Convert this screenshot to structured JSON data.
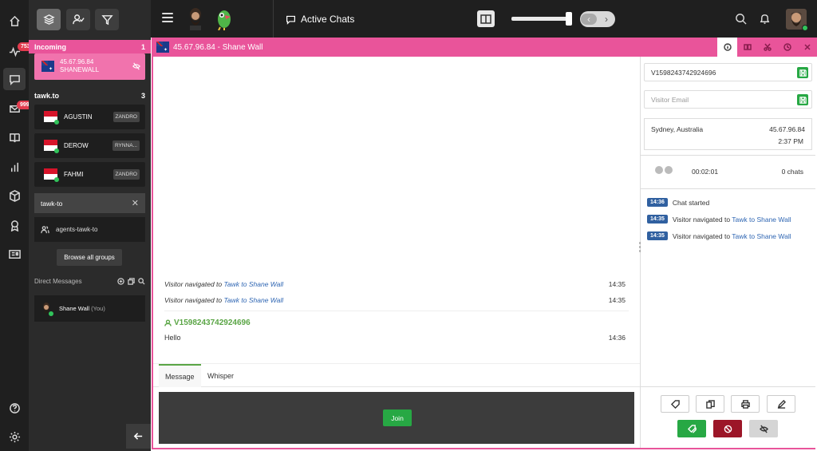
{
  "rail": {
    "activity_badge": "753",
    "inbox_badge": "999+"
  },
  "topbar": {
    "title": "Active Chats"
  },
  "sidebar": {
    "incoming": {
      "label": "Incoming",
      "count": "1",
      "item": {
        "ip": "45.67.96.84",
        "name": "SHANEWALL"
      }
    },
    "group": {
      "label": "tawk.to",
      "count": "3",
      "agents": [
        {
          "name": "AGUSTIN",
          "tag": "ZANDRO"
        },
        {
          "name": "DEROW",
          "tag": "RYNNA..."
        },
        {
          "name": "FAHMI",
          "tag": "ZANDRO"
        }
      ]
    },
    "group_search": {
      "value": "tawk-to"
    },
    "group_result": "agents-tawk-to",
    "browse_button": "Browse all groups",
    "direct_messages": {
      "label": "Direct Messages",
      "user": "Shane Wall",
      "you": "(You)"
    }
  },
  "chat": {
    "header_title": "45.67.96.84 - Shane Wall",
    "messages": [
      {
        "prefix": "Visitor navigated to ",
        "link": "Tawk to Shane Wall",
        "time": "14:35"
      },
      {
        "prefix": "Visitor navigated to ",
        "link": "Tawk to Shane Wall",
        "time": "14:35"
      }
    ],
    "visitor_id": "V1598243742924696",
    "visitor_message": {
      "text": "Hello",
      "time": "14:36"
    },
    "tabs": [
      "Message",
      "Whisper"
    ],
    "join_label": "Join"
  },
  "details": {
    "visitor_name_value": "V1598243742924696",
    "email_placeholder": "Visitor Email",
    "location": "Sydney, Australia",
    "ip": "45.67.96.84",
    "local_time": "2:37 PM",
    "duration": "00:02:01",
    "chat_count": "0 chats",
    "events": [
      {
        "time": "14:36",
        "text": "Chat started",
        "link": ""
      },
      {
        "time": "14:35",
        "text": "Visitor navigated to ",
        "link": "Tawk to Shane Wall"
      },
      {
        "time": "14:35",
        "text": "Visitor navigated to ",
        "link": "Tawk to Shane Wall"
      }
    ]
  },
  "colors": {
    "accent_pink": "#e9549a",
    "green": "#27a844",
    "red": "#9c1628",
    "rail_bg": "#1f1f1f"
  }
}
